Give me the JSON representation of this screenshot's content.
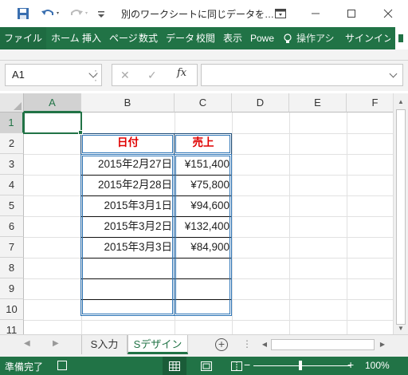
{
  "window": {
    "title": "別のワークシートに同じデータを…"
  },
  "ribbon": {
    "tabs": [
      "ファイル",
      "ホーム",
      "挿入",
      "ページ",
      "数式",
      "データ",
      "校閲",
      "表示",
      "Powe"
    ],
    "tell_me": "操作アシ",
    "signin": "サインイン"
  },
  "formula_bar": {
    "name_box": "A1",
    "formula": ""
  },
  "grid": {
    "columns": [
      "A",
      "B",
      "C",
      "D",
      "E",
      "F"
    ],
    "rows": [
      "1",
      "2",
      "3",
      "4",
      "5",
      "6",
      "7",
      "8",
      "9",
      "10",
      "11"
    ],
    "header_cells": {
      "date": "日付",
      "sales": "売上"
    },
    "data_rows": [
      {
        "date": "2015年2月27日",
        "sales": "¥151,400"
      },
      {
        "date": "2015年2月28日",
        "sales": "¥75,800"
      },
      {
        "date": "2015年3月1日",
        "sales": "¥94,600"
      },
      {
        "date": "2015年3月2日",
        "sales": "¥132,400"
      },
      {
        "date": "2015年3月3日",
        "sales": "¥84,900"
      }
    ],
    "active_cell": "A1"
  },
  "sheets": {
    "tabs": [
      "S入力",
      "Sデザイン"
    ],
    "active": "Sデザイン"
  },
  "status": {
    "ready": "準備完了",
    "zoom": "100%"
  },
  "colors": {
    "accent": "#217346",
    "header_text": "#e00000",
    "table_border": "#1f4e79"
  }
}
